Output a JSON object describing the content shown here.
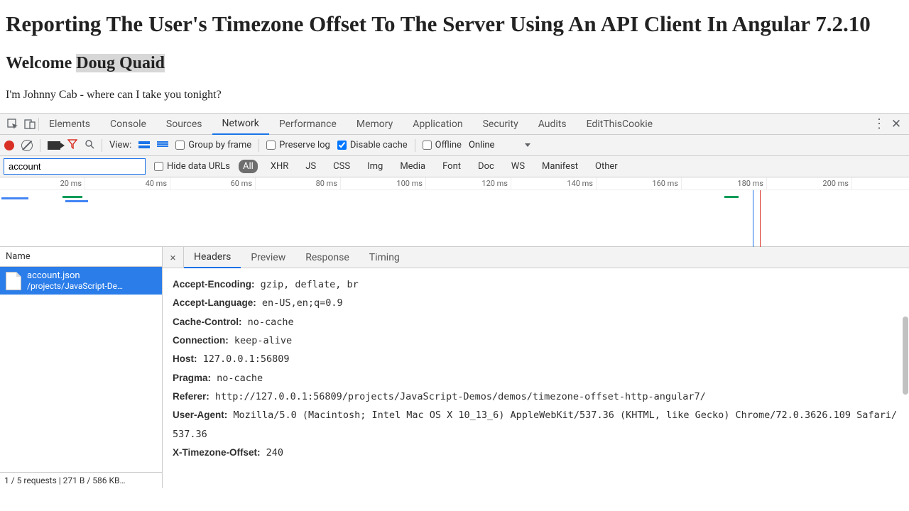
{
  "page": {
    "title": "Reporting The User's Timezone Offset To The Server Using An API Client In Angular 7.2.10",
    "welcome_prefix": "Welcome ",
    "welcome_name": "Doug Quaid",
    "body": "I'm Johnny Cab - where can I take you tonight?"
  },
  "devtools": {
    "tabs": [
      "Elements",
      "Console",
      "Sources",
      "Network",
      "Performance",
      "Memory",
      "Application",
      "Security",
      "Audits",
      "EditThisCookie"
    ],
    "active_tab": "Network",
    "toolbar": {
      "view_label": "View:",
      "group_by_frame": "Group by frame",
      "preserve_log": "Preserve log",
      "disable_cache": "Disable cache",
      "offline": "Offline",
      "online": "Online"
    },
    "filter": {
      "value": "account",
      "hide_data_urls": "Hide data URLs",
      "types": [
        "All",
        "XHR",
        "JS",
        "CSS",
        "Img",
        "Media",
        "Font",
        "Doc",
        "WS",
        "Manifest",
        "Other"
      ],
      "active_type": "All"
    },
    "timeline_ticks": [
      "20 ms",
      "40 ms",
      "60 ms",
      "80 ms",
      "100 ms",
      "120 ms",
      "140 ms",
      "160 ms",
      "180 ms",
      "200 ms"
    ],
    "request_list": {
      "header": "Name",
      "item": {
        "name": "account.json",
        "path": "/projects/JavaScript-De…"
      },
      "footer": "1 / 5 requests | 271 B / 586 KB…"
    },
    "detail_tabs": [
      "Headers",
      "Preview",
      "Response",
      "Timing"
    ],
    "active_detail_tab": "Headers",
    "headers": [
      {
        "k": "Accept-Encoding:",
        "v": " gzip, deflate, br"
      },
      {
        "k": "Accept-Language:",
        "v": " en-US,en;q=0.9"
      },
      {
        "k": "Cache-Control:",
        "v": " no-cache"
      },
      {
        "k": "Connection:",
        "v": " keep-alive"
      },
      {
        "k": "Host:",
        "v": " 127.0.0.1:56809"
      },
      {
        "k": "Pragma:",
        "v": " no-cache"
      },
      {
        "k": "Referer:",
        "v": " http://127.0.0.1:56809/projects/JavaScript-Demos/demos/timezone-offset-http-angular7/"
      },
      {
        "k": "User-Agent:",
        "v": " Mozilla/5.0 (Macintosh; Intel Mac OS X 10_13_6) AppleWebKit/537.36 (KHTML, like Gecko) Chrome/72.0.3626.109 Safari/537.36"
      },
      {
        "k": "X-Timezone-Offset:",
        "v": " 240"
      }
    ]
  }
}
